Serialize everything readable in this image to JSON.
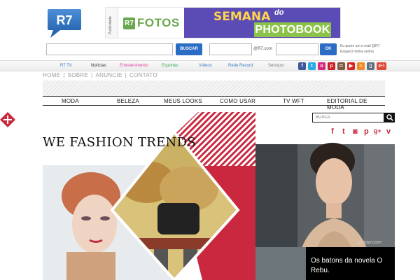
{
  "portal": {
    "logo_text": "R7",
    "ad": {
      "publicidade": "Publicidade",
      "r7_mark": "R7",
      "fotos": "FOTOS",
      "semana": "SEMANA",
      "do": "do",
      "photobook": "PHOTOBOOK"
    },
    "search_button": "BUSCAR",
    "email_domain": "@R7.com",
    "ok_button": "OK",
    "email_links": [
      "Eu quero um e-mail @R7",
      "Esqueci minha senha"
    ]
  },
  "portal_nav": [
    {
      "label": "R7 TV",
      "color": "#3b79c3"
    },
    {
      "label": "Notícias",
      "color": "#333333"
    },
    {
      "label": "Entretenimento",
      "color": "#e0419c"
    },
    {
      "label": "Esportes",
      "color": "#3aa655"
    },
    {
      "label": "Vídeos",
      "color": "#3b79c3"
    },
    {
      "label": "Rede Record",
      "color": "#3b79c3"
    },
    {
      "label": "Serviços",
      "color": "#777777"
    }
  ],
  "portal_social": [
    {
      "icon": "facebook-icon",
      "glyph": "f",
      "color": "#3b5998"
    },
    {
      "icon": "twitter-icon",
      "glyph": "t",
      "color": "#29a9e1"
    },
    {
      "icon": "orkut-icon",
      "glyph": "o",
      "color": "#d6297d"
    },
    {
      "icon": "pinterest-icon",
      "glyph": "p",
      "color": "#cb2027"
    },
    {
      "icon": "instagram-icon",
      "glyph": "◘",
      "color": "#7a5a40"
    },
    {
      "icon": "youtube-icon",
      "glyph": "▶",
      "color": "#d92520"
    },
    {
      "icon": "rss-icon",
      "glyph": "≈",
      "color": "#f08a24"
    },
    {
      "icon": "mobile-icon",
      "glyph": "▯",
      "color": "#5d6f80"
    },
    {
      "icon": "google-plus-icon",
      "glyph": "g+1",
      "color": "#dd4b39"
    }
  ],
  "blog_links": [
    "HOME",
    "|",
    "SOBRE",
    "|",
    "ANUNCIE",
    "|",
    "CONTATO"
  ],
  "main_nav": [
    "MODA",
    "BELEZA",
    "MEUS LOOKS",
    "COMO USAR",
    "TV WFT",
    "EDITORIAL DE MODA"
  ],
  "search_placeholder": "BUSCA",
  "blog_social": [
    {
      "icon": "facebook-icon",
      "glyph": "f"
    },
    {
      "icon": "twitter-icon",
      "glyph": "t"
    },
    {
      "icon": "instagram-icon",
      "glyph": "◙"
    },
    {
      "icon": "pinterest-icon",
      "glyph": "p"
    },
    {
      "icon": "google-plus-icon",
      "glyph": "g+"
    },
    {
      "icon": "vine-icon",
      "glyph": "v"
    }
  ],
  "blog_title": "WE FASHION TRENDS",
  "hero": {
    "caption": "Os batons da novela O Rebu.",
    "watermark": "gshow.com",
    "accent_color": "#c9283e"
  }
}
